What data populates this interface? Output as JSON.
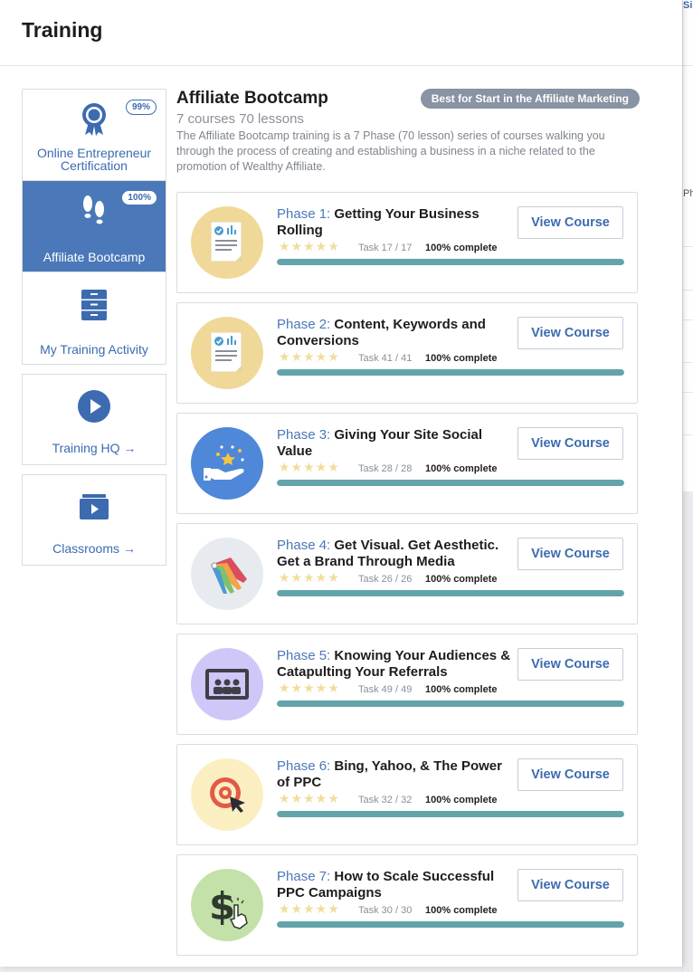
{
  "panel": {
    "title": "Training"
  },
  "background": {
    "fragment_top": "Si",
    "fragment_mid": "Ph"
  },
  "sidebar": {
    "items": [
      {
        "label": "Online Entrepreneur Certification",
        "badge": "99%",
        "icon": "certificate-ribbon-icon"
      },
      {
        "label": "Affiliate Bootcamp",
        "badge": "100%",
        "icon": "footprints-icon"
      },
      {
        "label": "My Training Activity",
        "icon": "filing-cabinet-icon"
      }
    ],
    "boxes": [
      {
        "label": "Training HQ",
        "icon": "play-circle-icon"
      },
      {
        "label": "Classrooms",
        "icon": "video-folder-icon"
      }
    ]
  },
  "course": {
    "title": "Affiliate Bootcamp",
    "badge": "Best for Start in the Affiliate Marketing",
    "subtitle": "7 courses 70 lessons",
    "description": "The Affiliate Bootcamp training is a 7 Phase (70 lesson) series of courses walking you through the process of creating and establishing a business in a niche related to the promotion of Wealthy Affiliate."
  },
  "phases": [
    {
      "phase": "Phase 1:",
      "name": "Getting Your Business Rolling",
      "task": "Task 17 / 17",
      "complete": "100% complete",
      "progress": 1.0,
      "button": "View Course",
      "icon": "document-chart-icon",
      "thumb_color": "#f0d899"
    },
    {
      "phase": "Phase 2:",
      "name": "Content, Keywords and Conversions",
      "task": "Task 41 / 41",
      "complete": "100% complete",
      "progress": 1.0,
      "button": "View Course",
      "icon": "document-chart-icon",
      "thumb_color": "#f0d899"
    },
    {
      "phase": "Phase 3:",
      "name": "Giving Your Site Social Value",
      "task": "Task 28 / 28",
      "complete": "100% complete",
      "progress": 1.0,
      "button": "View Course",
      "icon": "hand-stars-icon",
      "thumb_color": "#4f87d9"
    },
    {
      "phase": "Phase 4:",
      "name": "Get Visual.  Get Aesthetic. Get a Brand Through Media",
      "task": "Task 26 / 26",
      "complete": "100% complete",
      "progress": 1.0,
      "button": "View Course",
      "icon": "color-swatch-icon",
      "thumb_color": "#e7eaee"
    },
    {
      "phase": "Phase 5:",
      "name": "Knowing Your Audiences & Catapulting Your Referrals",
      "task": "Task 49 / 49",
      "complete": "100% complete",
      "progress": 1.0,
      "button": "View Course",
      "icon": "audience-screen-icon",
      "thumb_color": "#cfc7f7"
    },
    {
      "phase": "Phase 6:",
      "name": "Bing, Yahoo, & The Power of PPC",
      "task": "Task 32 / 32",
      "complete": "100% complete",
      "progress": 1.0,
      "button": "View Course",
      "icon": "target-cursor-icon",
      "thumb_color": "#fbefc2"
    },
    {
      "phase": "Phase 7:",
      "name": "How to Scale Successful PPC Campaigns",
      "task": "Task 30 / 30",
      "complete": "100% complete",
      "progress": 1.0,
      "button": "View Course",
      "icon": "dollar-click-icon",
      "thumb_color": "#c3e1a8"
    }
  ],
  "rating_stars": "★★★★★"
}
